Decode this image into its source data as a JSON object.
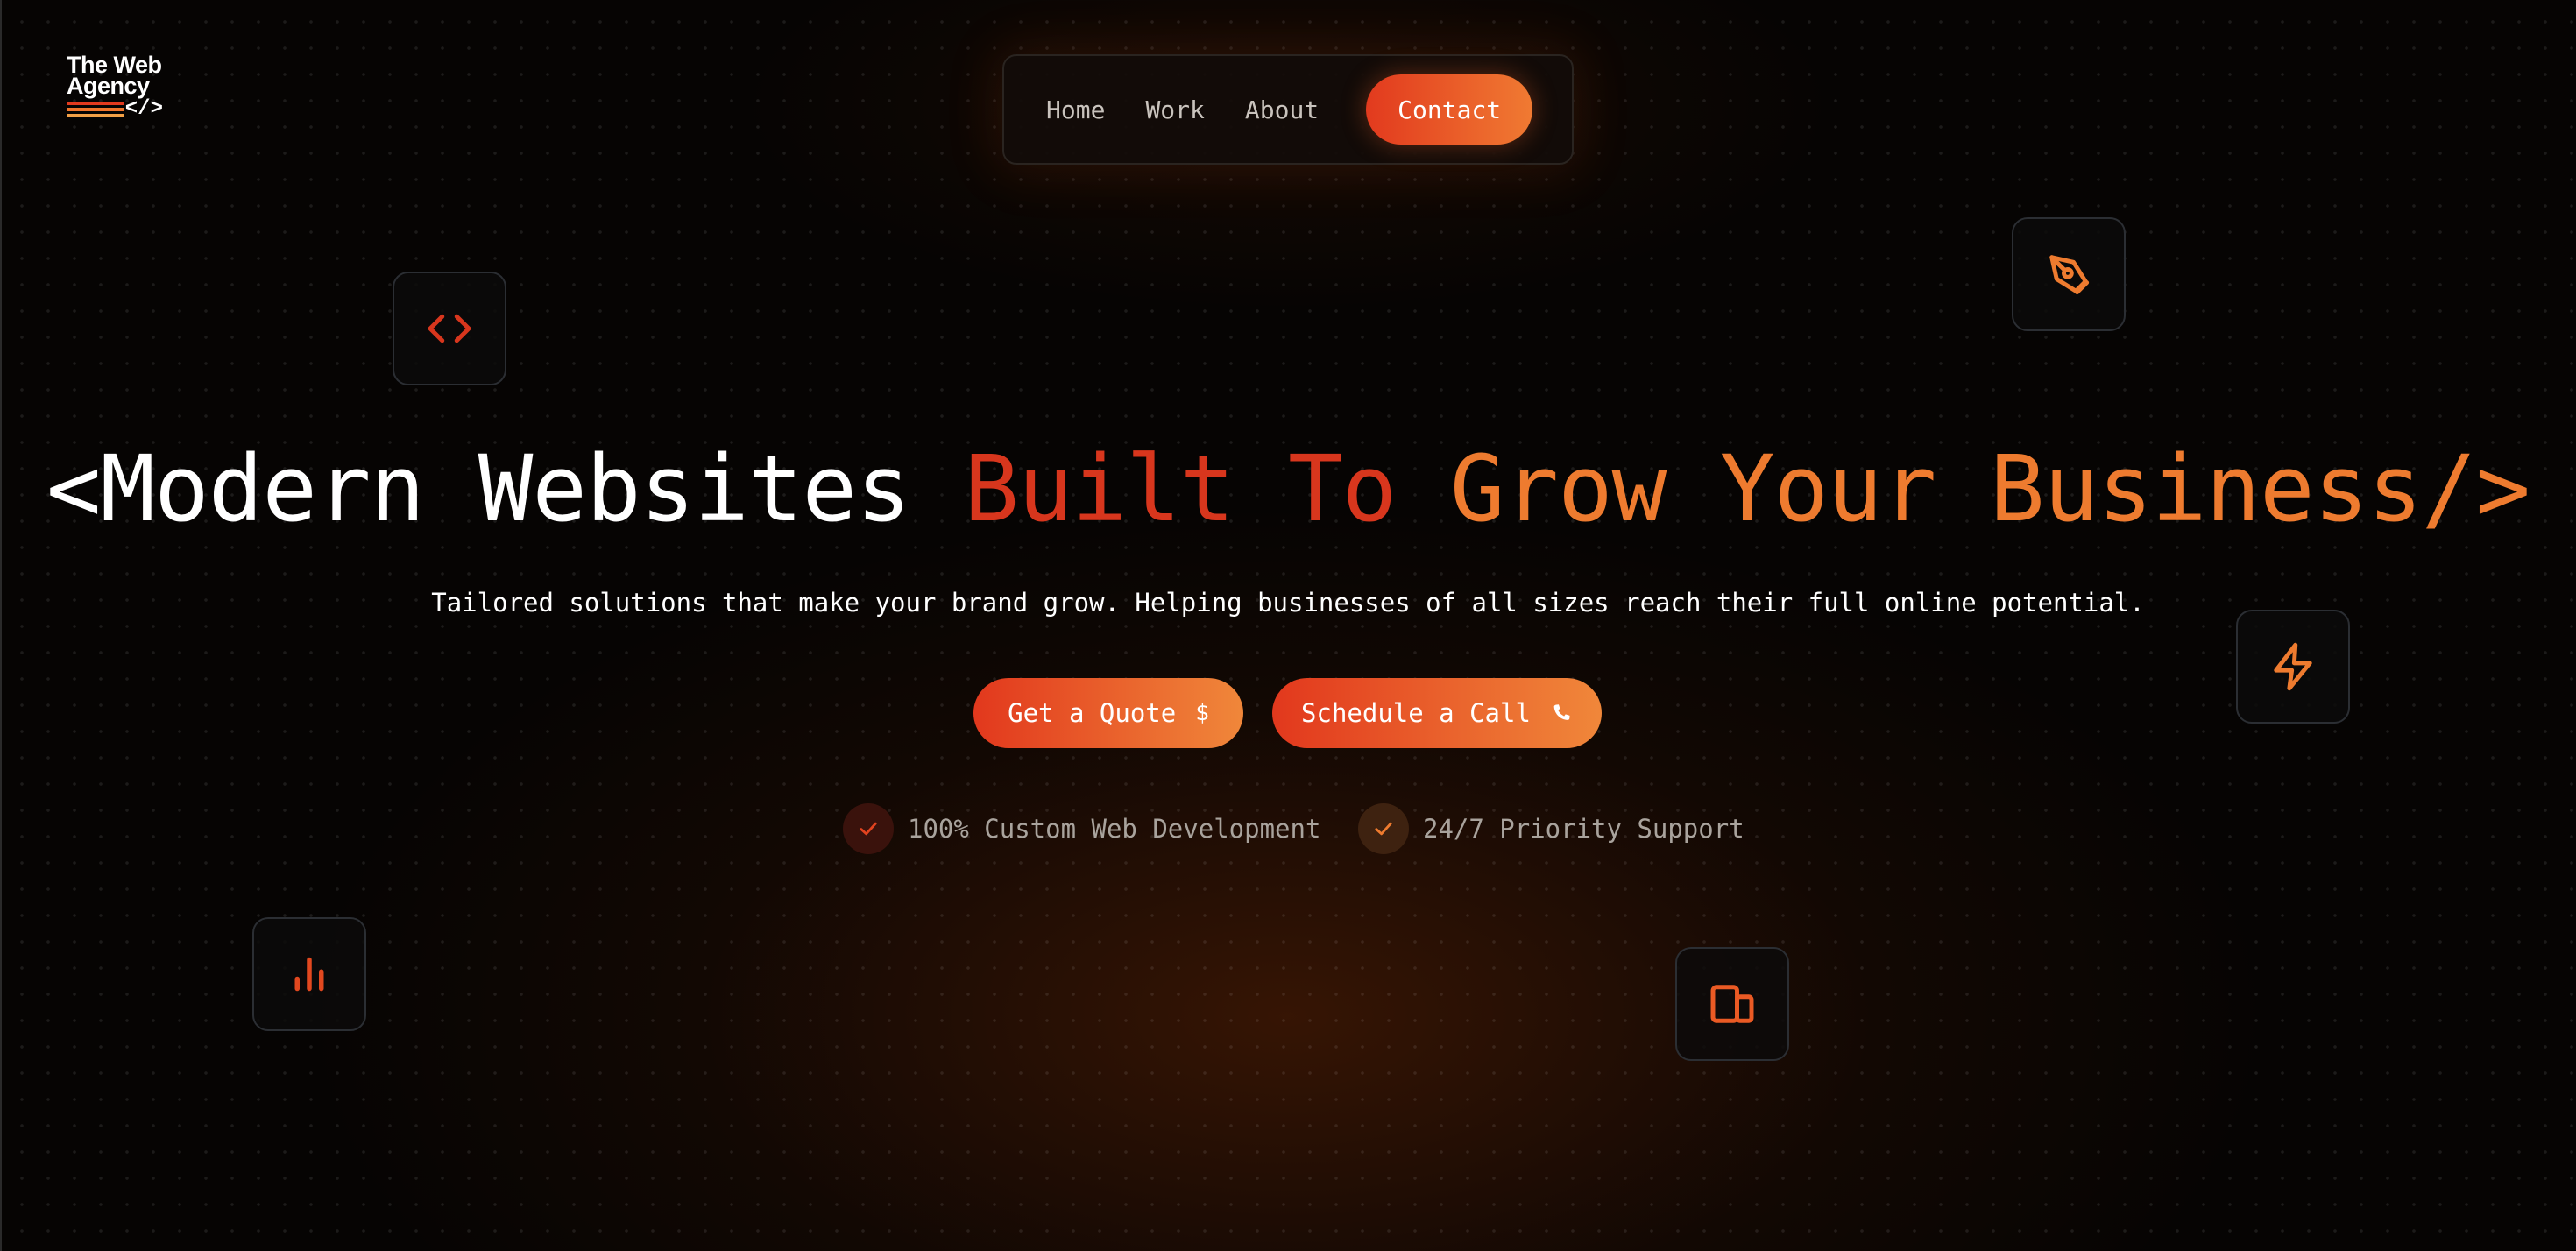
{
  "brand": {
    "line1": "The Web",
    "line2": "Agency",
    "code_glyph": "</>",
    "stripe_colors": [
      "#e23a1e",
      "#f0762c",
      "#f2a046"
    ]
  },
  "nav": {
    "items": [
      {
        "label": "Home"
      },
      {
        "label": "Work"
      },
      {
        "label": "About"
      }
    ],
    "contact_label": "Contact"
  },
  "hero": {
    "title_parts": [
      {
        "text": "<Modern Websites ",
        "color": "#ffffff"
      },
      {
        "text": "Built To ",
        "color": "#d8361d"
      },
      {
        "text": "Grow Your Business/>",
        "color": "#ee7b2f"
      }
    ],
    "subtitle": "Tailored solutions that make your brand grow. Helping businesses of all sizes reach their full online potential.",
    "cta_primary": {
      "label": "Get a Quote",
      "icon": "dollar-icon"
    },
    "cta_secondary": {
      "label": "Schedule a Call",
      "icon": "phone-icon"
    },
    "features": [
      {
        "label": "100% Custom Web Development",
        "icon": "check-icon",
        "accent": "#d8361d"
      },
      {
        "label": "24/7 Priority Support",
        "icon": "check-icon",
        "accent": "#ee7b2f"
      }
    ]
  },
  "floating_icons": [
    {
      "name": "code-icon",
      "color": "#d8361d"
    },
    {
      "name": "pen-tool-icon",
      "color": "#ee7b2f"
    },
    {
      "name": "lightning-icon",
      "color": "#ee7b2f"
    },
    {
      "name": "bar-chart-icon",
      "color": "#e2481f"
    },
    {
      "name": "devices-icon",
      "color": "#ea5a24"
    }
  ],
  "colors": {
    "background": "#060403",
    "accent_red": "#d8361d",
    "accent_orange": "#ee7b2f",
    "gradient_start": "#e2381d",
    "gradient_end": "#f0873a"
  }
}
